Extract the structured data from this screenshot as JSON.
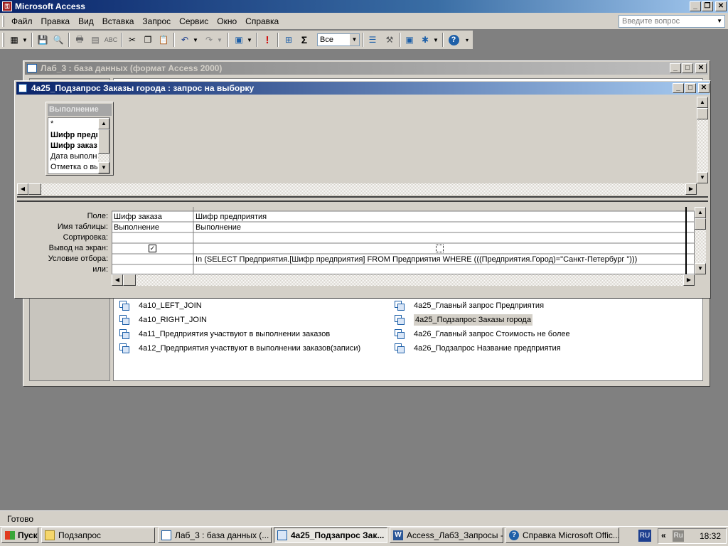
{
  "app": {
    "title": "Microsoft Access",
    "icon": "access-key-icon"
  },
  "menu": {
    "items": [
      "Файл",
      "Правка",
      "Вид",
      "Вставка",
      "Запрос",
      "Сервис",
      "Окно",
      "Справка"
    ],
    "help_placeholder": "Введите вопрос"
  },
  "toolbar": {
    "top_values": "Все"
  },
  "db_window": {
    "title": "Лаб_3 : база данных (формат Access 2000)",
    "list_left": [
      "4a10_LEFT_JOIN",
      "4a10_RIGHT_JOIN",
      "4a11_Предприятия участвуют в выполнении заказов",
      "4a12_Предприятия участвуют в выполнении заказов(записи)"
    ],
    "list_right": [
      "4a25_Главный запрос Предприятия",
      "4a25_Подзапрос Заказы города",
      "4a26_Главный запрос Стоимость не более",
      "4a26_Подзапрос Название предприятия"
    ],
    "selected_item": "4a25_Подзапрос Заказы города"
  },
  "query_window": {
    "title": "4a25_Подзапрос Заказы города : запрос на выборку",
    "table_box": {
      "name": "Выполнение",
      "fields": [
        "*",
        "Шифр предп",
        "Шифр заказа",
        "Дата выполн",
        "Отметка о вы"
      ]
    },
    "grid": {
      "row_labels": [
        "Поле:",
        "Имя таблицы:",
        "Сортировка:",
        "Вывод на экран:",
        "Условие отбора:",
        "или:"
      ],
      "columns": [
        {
          "field": "Шифр заказа",
          "table": "Выполнение",
          "sort": "",
          "show": true,
          "criteria": ""
        },
        {
          "field": "Шифр предприятия",
          "table": "Выполнение",
          "sort": "",
          "show": false,
          "criteria": "In (SELECT Предприятия.[Шифр предприятия] FROM Предприятия WHERE (((Предприятия.Город)=\"Санкт-Петербург \")))"
        }
      ]
    }
  },
  "status": {
    "text": "Готово"
  },
  "taskbar": {
    "start": "Пуск",
    "buttons": [
      {
        "label": "Подзапрос",
        "icon": "folder-icon"
      },
      {
        "label": "Лаб_3 : база данных (...",
        "icon": "database-icon"
      },
      {
        "label": "4a25_Подзапрос Зак...",
        "icon": "query-icon"
      },
      {
        "label": "Access_Лаб3_Запросы -...",
        "icon": "word-icon"
      },
      {
        "label": "Справка Microsoft Offic...",
        "icon": "help-icon"
      }
    ],
    "lang": "RU",
    "tray_lang": "Ru",
    "clock": "18:32"
  }
}
